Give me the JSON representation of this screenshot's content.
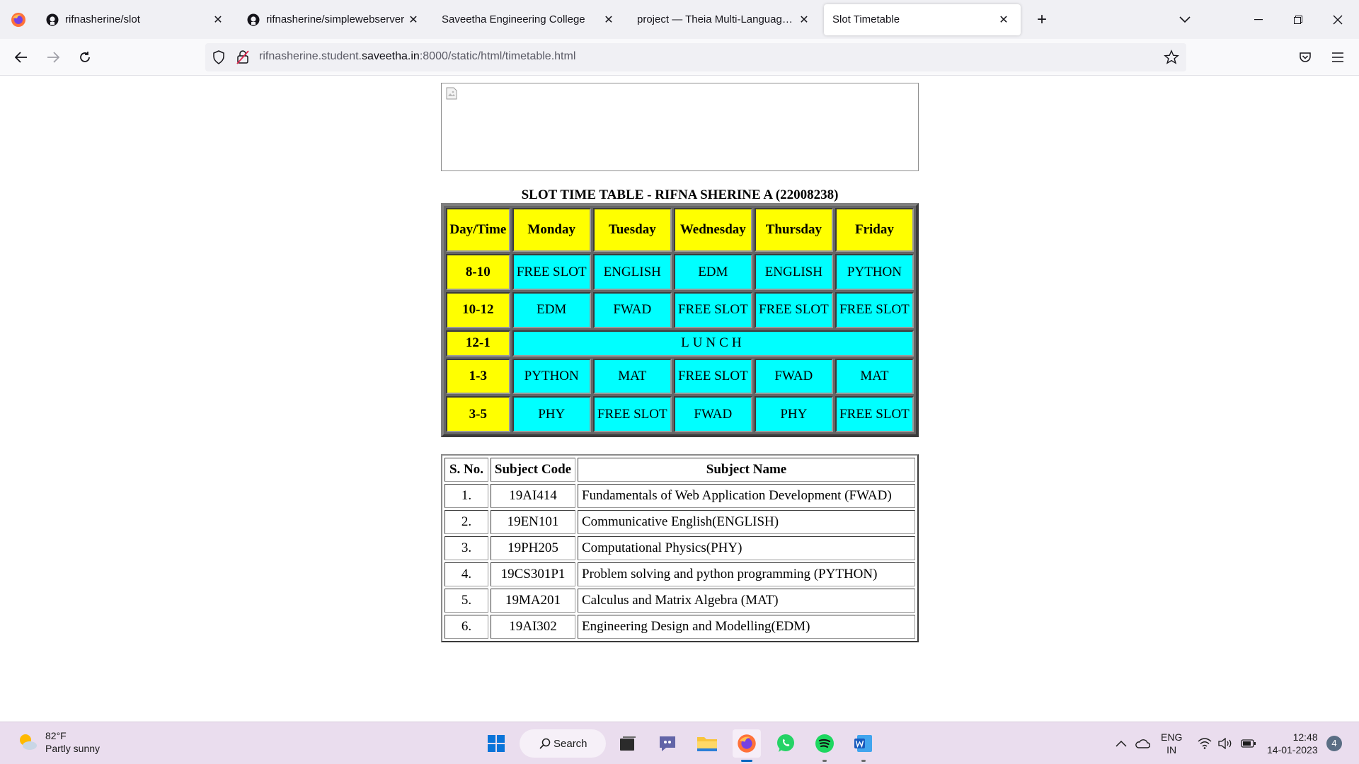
{
  "browser": {
    "tabs": [
      {
        "label": "rifnasherine/slot",
        "icon": "github-icon",
        "active": false
      },
      {
        "label": "rifnasherine/simplewebserver",
        "icon": "github-icon",
        "active": false
      },
      {
        "label": "Saveetha Engineering College",
        "icon": "none",
        "active": false
      },
      {
        "label": "project — Theia Multi-Language Ex",
        "icon": "none",
        "active": false
      },
      {
        "label": "Slot Timetable",
        "icon": "none",
        "active": true
      }
    ],
    "url_prefix": "rifnasherine.student.",
    "url_domain": "saveetha.in",
    "url_suffix": ":8000/static/html/timetable.html"
  },
  "page": {
    "timetable_title": "SLOT TIME TABLE - RIFNA SHERINE A (22008238)",
    "timetable": {
      "headers": [
        "Day/Time",
        "Monday",
        "Tuesday",
        "Wednesday",
        "Thursday",
        "Friday"
      ],
      "rows": [
        {
          "slot": "8-10",
          "cells": [
            "FREE SLOT",
            "ENGLISH",
            "EDM",
            "ENGLISH",
            "PYTHON"
          ]
        },
        {
          "slot": "10-12",
          "cells": [
            "EDM",
            "FWAD",
            "FREE SLOT",
            "FREE SLOT",
            "FREE SLOT"
          ]
        },
        {
          "slot": "12-1",
          "lunch": "LUNCH"
        },
        {
          "slot": "1-3",
          "cells": [
            "PYTHON",
            "MAT",
            "FREE SLOT",
            "FWAD",
            "MAT"
          ]
        },
        {
          "slot": "3-5",
          "cells": [
            "PHY",
            "FREE SLOT",
            "FWAD",
            "PHY",
            "FREE SLOT"
          ]
        }
      ]
    },
    "subjects": {
      "headers": [
        "S. No.",
        "Subject Code",
        "Subject Name"
      ],
      "rows": [
        [
          "1.",
          "19AI414",
          "Fundamentals of Web Application Development (FWAD)"
        ],
        [
          "2.",
          "19EN101",
          "Communicative English(ENGLISH)"
        ],
        [
          "3.",
          "19PH205",
          "Computational Physics(PHY)"
        ],
        [
          "4.",
          "19CS301P1",
          "Problem solving and python programming (PYTHON)"
        ],
        [
          "5.",
          "19MA201",
          "Calculus and Matrix Algebra (MAT)"
        ],
        [
          "6.",
          "19AI302",
          "Engineering Design and Modelling(EDM)"
        ]
      ]
    },
    "colors": {
      "header_bg": "#ffff00",
      "cell_bg": "#00ffff"
    }
  },
  "taskbar": {
    "weather_temp": "82°F",
    "weather_desc": "Partly sunny",
    "search_label": "Search",
    "lang_line1": "ENG",
    "lang_line2": "IN",
    "time": "12:48",
    "date": "14-01-2023",
    "notification_count": "4"
  }
}
